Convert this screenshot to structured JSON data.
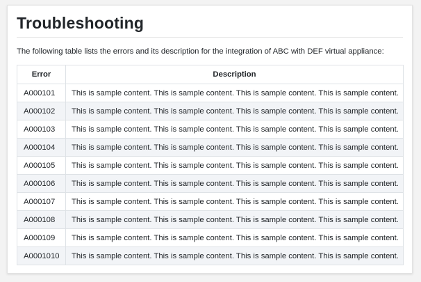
{
  "page": {
    "title": "Troubleshooting",
    "intro": "The following table lists the errors and its description for the integration of ABC with DEF virtual appliance:"
  },
  "table": {
    "headers": [
      "Error",
      "Description"
    ],
    "rows": [
      {
        "code": "A000101",
        "description": "This is sample content. This is sample content. This is sample content. This is sample content."
      },
      {
        "code": "A000102",
        "description": "This is sample content. This is sample content. This is sample content. This is sample content."
      },
      {
        "code": "A000103",
        "description": "This is sample content. This is sample content. This is sample content. This is sample content."
      },
      {
        "code": "A000104",
        "description": "This is sample content. This is sample content. This is sample content. This is sample content."
      },
      {
        "code": "A000105",
        "description": "This is sample content. This is sample content. This is sample content. This is sample content."
      },
      {
        "code": "A000106",
        "description": "This is sample content. This is sample content. This is sample content. This is sample content."
      },
      {
        "code": "A000107",
        "description": "This is sample content. This is sample content. This is sample content. This is sample content."
      },
      {
        "code": "A000108",
        "description": "This is sample content. This is sample content. This is sample content. This is sample content."
      },
      {
        "code": "A000109",
        "description": "This is sample content. This is sample content. This is sample content. This is sample content."
      },
      {
        "code": "A0001010",
        "description": "This is sample content. This is sample content. This is sample content. This is sample content."
      }
    ]
  }
}
